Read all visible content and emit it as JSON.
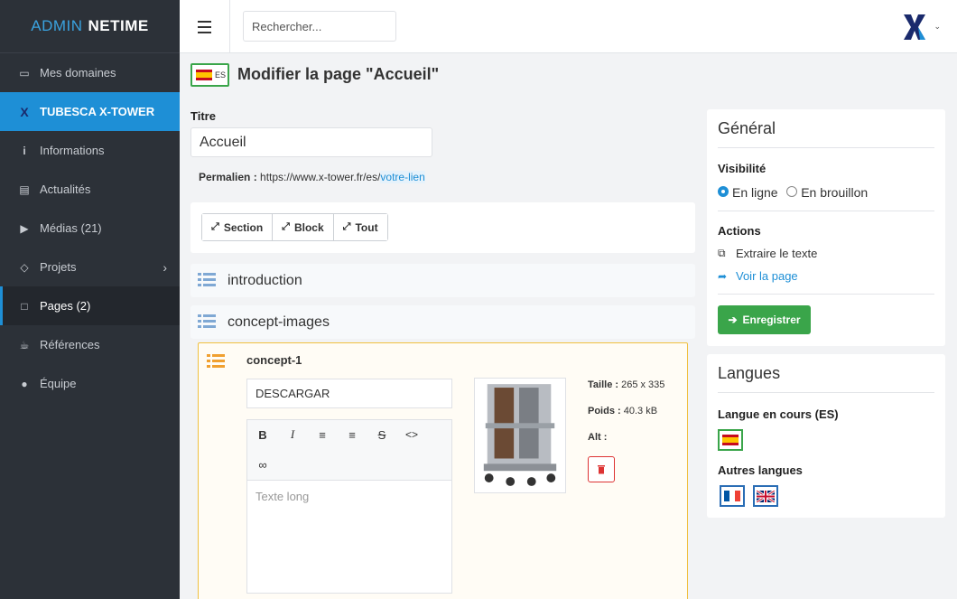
{
  "sidebar": {
    "brand_part1": "ADMIN",
    "brand_part2": "NETIME",
    "items": [
      {
        "label": "Mes domaines",
        "icon": "laptop-icon"
      },
      {
        "label": "TUBESCA X-TOWER",
        "icon": "x-logo-icon"
      },
      {
        "label": "Informations",
        "icon": "info-icon"
      },
      {
        "label": "Actualités",
        "icon": "newspaper-icon"
      },
      {
        "label": "Médias (21)",
        "icon": "video-icon"
      },
      {
        "label": "Projets",
        "icon": "diamond-icon"
      },
      {
        "label": "Pages (2)",
        "icon": "file-icon"
      },
      {
        "label": "Références",
        "icon": "coffee-icon"
      },
      {
        "label": "Équipe",
        "icon": "users-icon"
      }
    ]
  },
  "topbar": {
    "search_placeholder": "Rechercher..."
  },
  "page": {
    "lang_code": "ES",
    "title_prefix": "Modifier la page ",
    "title_name": "\"Accueil\"",
    "titre_label": "Titre",
    "titre_value": "Accueil",
    "permalink_label": "Permalien :",
    "permalink_base": " https://www.x-tower.fr/es/",
    "permalink_slug": "votre-lien",
    "tools": [
      {
        "label": "Section"
      },
      {
        "label": "Block"
      },
      {
        "label": "Tout"
      }
    ],
    "sections": [
      {
        "title": "introduction"
      },
      {
        "title": "concept-images"
      }
    ],
    "concept": {
      "title": "concept-1",
      "text_value": "DESCARGAR",
      "editor_placeholder": "Texte long",
      "taille_label": "Taille :",
      "taille_value": " 265 x 335",
      "poids_label": "Poids :",
      "poids_value": " 40.3 kB",
      "alt_label": "Alt :"
    }
  },
  "general_card": {
    "title": "Général",
    "visibility_label": "Visibilité",
    "option_online": "En ligne",
    "option_draft": "En brouillon",
    "actions_label": "Actions",
    "action_extract": "Extraire le texte",
    "action_view": "Voir la page",
    "save_label": "Enregistrer"
  },
  "lang_card": {
    "title": "Langues",
    "current_label": "Langue en cours (ES)",
    "others_label": "Autres langues"
  },
  "colors": {
    "accent": "#1e8fd6",
    "success": "#3aa54a",
    "sidebar": "#2c3138",
    "danger": "#dd3333",
    "concept_border": "#f0c040"
  }
}
